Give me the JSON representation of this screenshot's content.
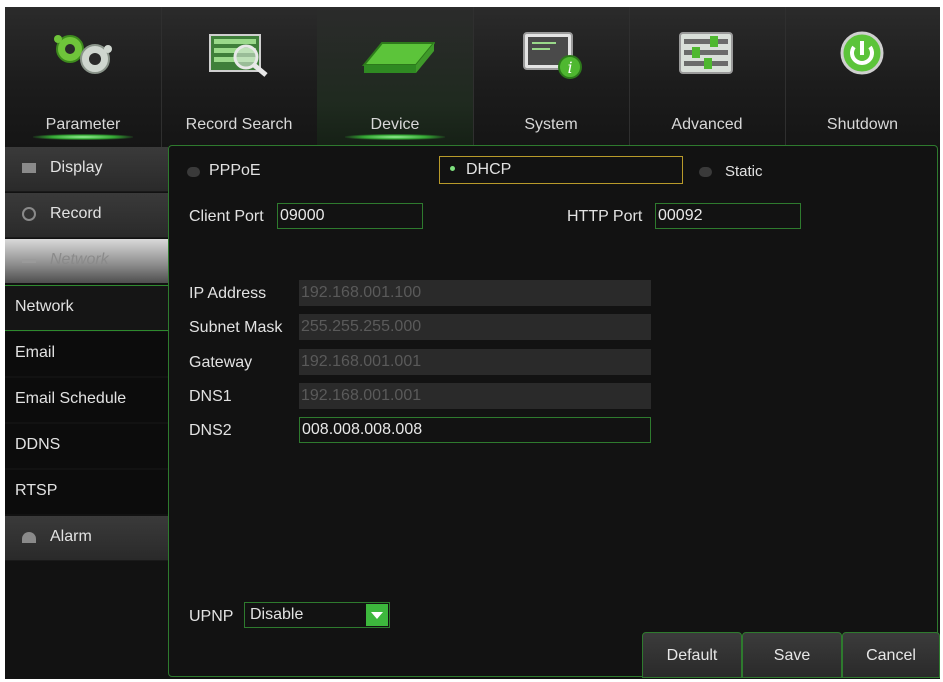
{
  "tabs": [
    {
      "label": "Parameter",
      "icon": "gears-icon"
    },
    {
      "label": "Record Search",
      "icon": "record-search-icon"
    },
    {
      "label": "Device",
      "icon": "hard-drive-icon"
    },
    {
      "label": "System",
      "icon": "system-info-icon"
    },
    {
      "label": "Advanced",
      "icon": "sliders-icon"
    },
    {
      "label": "Shutdown",
      "icon": "power-icon"
    }
  ],
  "menu": {
    "display": "Display",
    "record": "Record",
    "network_header": "Network",
    "network": "Network",
    "email": "Email",
    "email_schedule": "Email Schedule",
    "ddns": "DDNS",
    "rtsp": "RTSP",
    "alarm": "Alarm"
  },
  "modes": {
    "pppoe": "PPPoE",
    "dhcp": "DHCP",
    "static": "Static",
    "selected": "DHCP"
  },
  "ports": {
    "client_label": "Client Port",
    "client_value": "09000",
    "http_label": "HTTP Port",
    "http_value": "00092"
  },
  "addresses": {
    "ip_label": "IP Address",
    "ip_value": "192.168.001.100",
    "subnet_label": "Subnet Mask",
    "subnet_value": "255.255.255.000",
    "gateway_label": "Gateway",
    "gateway_value": "192.168.001.001",
    "dns1_label": "DNS1",
    "dns1_value": "192.168.001.001",
    "dns2_label": "DNS2",
    "dns2_value": "008.008.008.008"
  },
  "upnp": {
    "label": "UPNP",
    "value": "Disable"
  },
  "buttons": {
    "default": "Default",
    "save": "Save",
    "cancel": "Cancel"
  },
  "colors": {
    "accent_green": "#2e7a2e",
    "dhcp_border": "#b89a2a"
  }
}
